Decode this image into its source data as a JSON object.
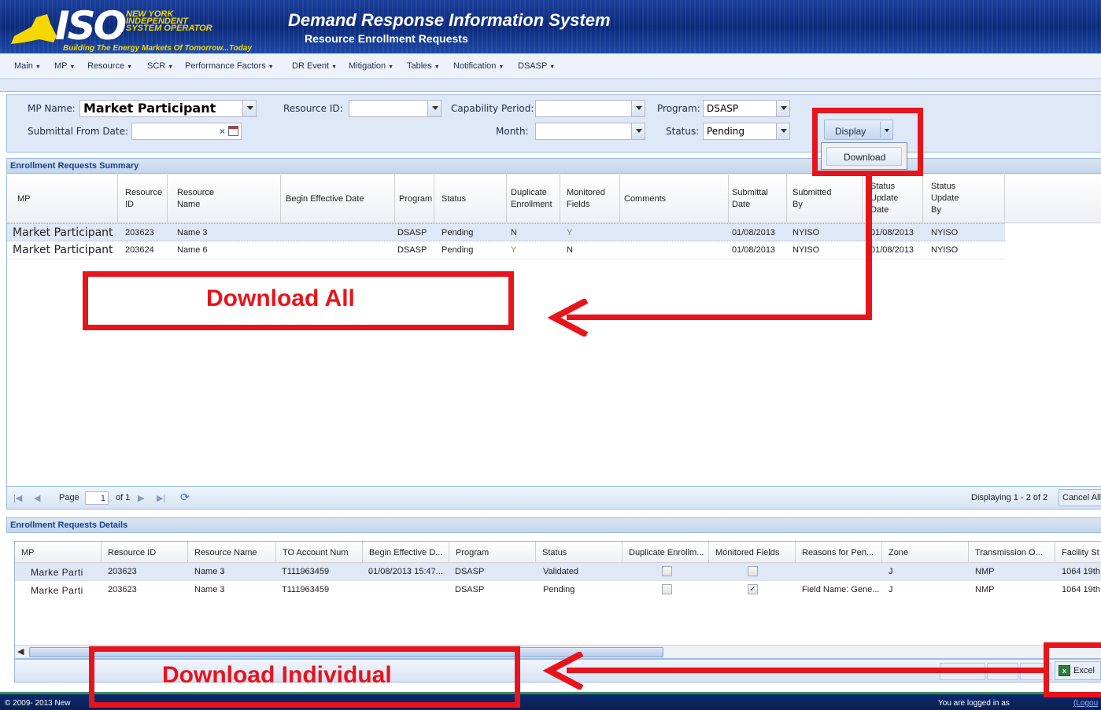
{
  "header": {
    "logo_text": "ISO",
    "logo_lines": [
      "NEW YORK",
      "INDEPENDENT",
      "SYSTEM OPERATOR"
    ],
    "logo_tagline": "Building The Energy Markets Of Tomorrow...Today",
    "title": "Demand Response Information System",
    "subtitle": "Resource Enrollment Requests"
  },
  "menu": [
    "Main",
    "MP",
    "Resource",
    "SCR",
    "Performance Factors",
    "DR Event",
    "Mitigation",
    "Tables",
    "Notification",
    "DSASP"
  ],
  "filters": {
    "mp_name_label": "MP Name:",
    "mp_name_value": "Market Participant",
    "resource_id_label": "Resource ID:",
    "resource_id_value": "",
    "capability_period_label": "Capability Period:",
    "capability_period_value": "",
    "program_label": "Program:",
    "program_value": "DSASP",
    "submittal_from_label": "Submittal From Date:",
    "submittal_from_value": "",
    "month_label": "Month:",
    "month_value": "",
    "status_label": "Status:",
    "status_value": "Pending",
    "display_button": "Display",
    "download_menu_item": "Download"
  },
  "summary": {
    "title": "Enrollment Requests Summary",
    "columns": [
      "MP",
      "Resource\nID",
      "Resource\nName",
      "Begin Effective Date",
      "Program",
      "Status",
      "Duplicate\nEnrollment",
      "Monitored\nFields",
      "Comments",
      "Submittal\nDate",
      "Submitted\nBy",
      "Status\nUpdate\nDate",
      "Status\nUpdate\nBy"
    ],
    "rows": [
      [
        "Market Participant",
        "203623",
        "Name 3",
        "",
        "DSASP",
        "Pending",
        "N",
        "Y",
        "",
        "01/08/2013",
        "NYISO",
        "01/08/2013",
        "NYISO"
      ],
      [
        "Market Participant",
        "203624",
        "Name 6",
        "",
        "DSASP",
        "Pending",
        "Y",
        "N",
        "",
        "01/08/2013",
        "NYISO",
        "01/08/2013",
        "NYISO"
      ]
    ]
  },
  "pager": {
    "page_label": "Page",
    "page_value": "1",
    "of_label": "of 1",
    "displaying": "Displaying 1 - 2 of 2",
    "cancel_all": "Cancel All"
  },
  "details": {
    "title": "Enrollment Requests Details",
    "columns": [
      "MP",
      "Resource ID",
      "Resource Name",
      "TO Account Num",
      "Begin Effective D...",
      "Program",
      "Status",
      "Duplicate Enrollm...",
      "Monitored Fields",
      "Reasons for Pen...",
      "Zone",
      "Transmission O...",
      "Facility St"
    ],
    "rows": [
      {
        "mp": "Marke Parti",
        "resource_id": "203623",
        "resource_name": "Name 3",
        "to_account": "T111963459",
        "begin": "01/08/2013 15:47...",
        "program": "DSASP",
        "status": "Validated",
        "dup": false,
        "mon": false,
        "reason": "",
        "zone": "J",
        "transmission": "NMP",
        "facility": "1064 19th"
      },
      {
        "mp": "Marke Parti",
        "resource_id": "203623",
        "resource_name": "Name 3",
        "to_account": "T111963459",
        "begin": "",
        "program": "DSASP",
        "status": "Pending",
        "dup": false,
        "mon": true,
        "reason": "Field Name: Gene...",
        "zone": "J",
        "transmission": "NMP",
        "facility": "1064 19th"
      }
    ],
    "excel_button": "Excel"
  },
  "footer": {
    "copyright": "© 2009- 2013 New",
    "logged_in": "You are logged in as",
    "logout": "(Logou"
  },
  "annotations": {
    "download_all": "Download All",
    "download_individual": "Download Individual",
    "color": "#e8141c"
  }
}
